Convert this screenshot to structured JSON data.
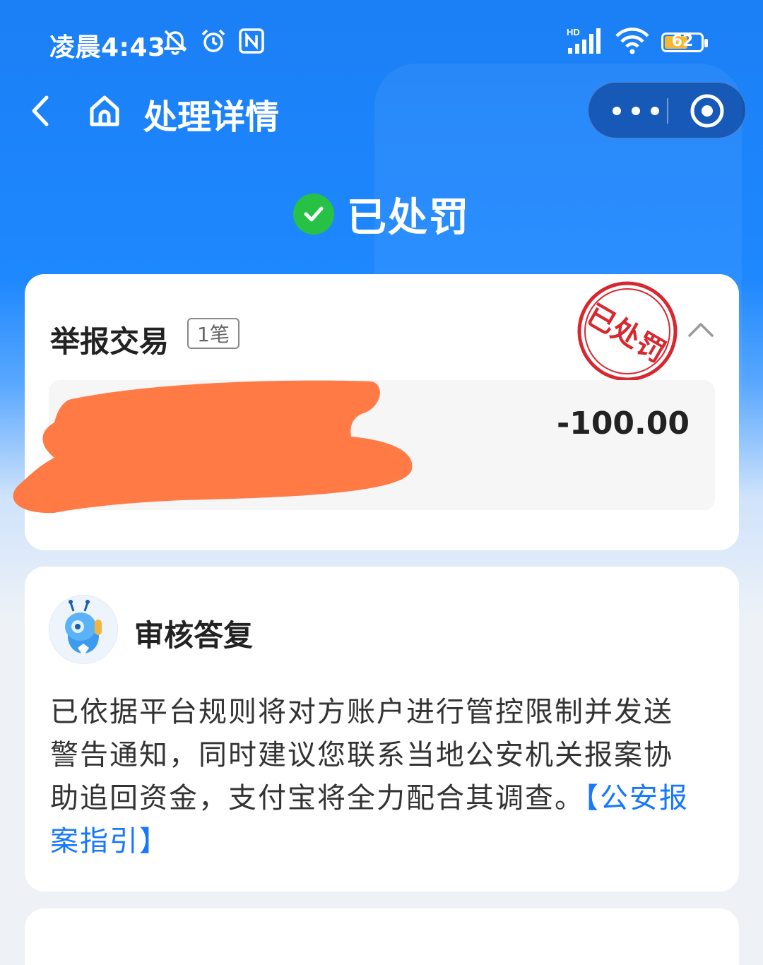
{
  "statusbar": {
    "time": "凌晨4:43",
    "network": "HD",
    "battery": "62",
    "icons_left": [
      "bell-off-icon",
      "alarm-icon",
      "nfc-icon"
    ],
    "icons_right": [
      "signal-icon",
      "wifi-icon",
      "battery-icon"
    ]
  },
  "nav": {
    "title": "处理详情",
    "back_icon": "chevron-left-icon",
    "home_icon": "home-icon",
    "capsule": {
      "more_icon": "more-dots-icon",
      "close_icon": "target-icon"
    }
  },
  "status": {
    "label": "已处罚",
    "icon": "check-circle-icon",
    "color": "#27c145"
  },
  "report": {
    "title": "举报交易",
    "count_badge": "1笔",
    "stamp_text": "已处罚",
    "stamp_color": "#d7282f",
    "transaction": {
      "amount": "-100.00"
    }
  },
  "review": {
    "title": "审核答复",
    "body": "已依据平台规则将对方账户进行管控限制并发送警告通知，同时建议您联系当地公安机关报案协助追回资金，支付宝将全力配合其调查。",
    "link_text": "【公安报案指引】",
    "link_color": "#1677ff"
  },
  "colors": {
    "primary": "#1e88ff",
    "redaction": "#ff7a45"
  }
}
